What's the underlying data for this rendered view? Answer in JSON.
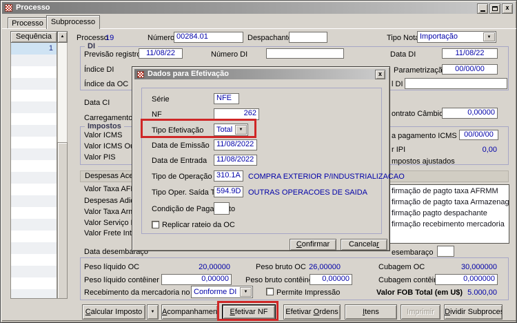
{
  "colors": {
    "accent_blue": "#0000a8",
    "annotation_red": "#cf2727",
    "selection_blue": "#cfe3f3"
  },
  "window": {
    "title": "Processo"
  },
  "tabs": {
    "items": [
      {
        "label": "Processo"
      },
      {
        "label": "Subprocesso"
      }
    ],
    "active": "Subprocesso"
  },
  "sidebar": {
    "header": "Sequência",
    "selected_row": "1"
  },
  "top": {
    "processo_label": "Processo",
    "processo_value": "19",
    "numero_po_label": "Número PO",
    "numero_po_value": "00284.01",
    "despachante_label": "Despachante",
    "despachante_value": "",
    "tipo_nota_label": "Tipo Nota",
    "tipo_nota_value": "Importação"
  },
  "di": {
    "title": "DI",
    "previsao_registro_label": "Previsão registro",
    "previsao_registro_value": "11/08/22",
    "numero_di_label": "Número DI",
    "numero_di_value": "",
    "data_di_label": "Data DI",
    "data_di_value": "11/08/22",
    "indice_di_label": "Índice DI",
    "parametrizacao_di_label": "Parametrização DI",
    "parametrizacao_di_value": "00/00/00",
    "indice_da_oc_label": "Índice da OC",
    "canal_di_label_fragment": "l DI",
    "canal_di_value": ""
  },
  "middle": {
    "data_ci_label": "Data CI",
    "carregamento_label": "Carregamento",
    "contrato_cambio_label_fragment": "ontrato Câmbio",
    "contrato_cambio_value": "0,00000"
  },
  "impostos": {
    "title": "Impostos",
    "valor_icms_label": "Valor ICMS",
    "valor_icms_outros_label": "Valor ICMS Outros",
    "valor_pis_label": "Valor PIS",
    "pagamento_icms_label_fragment": "a pagamento ICMS",
    "pagamento_icms_value": "00/00/00",
    "ipi_label_fragment": "r IPI",
    "ipi_value": "0,00",
    "ajustados_label_fragment": "mpostos ajustados"
  },
  "despesas": {
    "tab_label_fragment": "Despesas Acessória",
    "rows": [
      "Valor Taxa AFRMM",
      "Despesas Adiciona",
      "Valor Taxa Armaze",
      "Valor Serviço Desp",
      "Valor Frete Interno"
    ]
  },
  "confirmacoes": {
    "items": [
      "firmação de pagto taxa AFRMM",
      "firmação de pagto taxa Armazenagem",
      "firmação pagto despachante",
      "firmação recebimento mercadoria"
    ]
  },
  "desembaraco": {
    "left_label": "Data desembaraço",
    "right_label_fragment": "esembaraço",
    "right_value": ""
  },
  "totais": {
    "peso_liquido_oc_label": "Peso líquido OC",
    "peso_liquido_oc_value": "20,00000",
    "peso_bruto_oc_label": "Peso bruto OC",
    "peso_bruto_oc_value": "26,00000",
    "cubagem_oc_label": "Cubagem OC",
    "cubagem_oc_value": "30,000000",
    "peso_liquido_cont_label": "Peso líquido contêiner",
    "peso_liquido_cont_value": "0,00000",
    "peso_bruto_cont_label": "Peso bruto contêiner",
    "peso_bruto_cont_value": "0,00000",
    "cubagem_cont_label": "Cubagem contêiner",
    "cubagem_cont_value": "0,000000",
    "recebimento_label": "Recebimento da mercadoria no CD",
    "recebimento_value": "Conforme DI",
    "permite_label": "Permite Impressão",
    "fob_label": "Valor FOB Total (em U$)",
    "fob_value": "5.000,00"
  },
  "actions": {
    "buttons": [
      {
        "label": "Calcular Imposto",
        "disabled": false
      },
      {
        "label": "Acompanhamento",
        "disabled": false
      },
      {
        "label": "Efetivar NF",
        "disabled": false
      },
      {
        "label": "Efetivar Ordens",
        "disabled": false
      },
      {
        "label": "Itens",
        "disabled": false
      },
      {
        "label": "Imprimir",
        "disabled": true
      },
      {
        "label": "Dividir Subprocesso",
        "disabled": false
      }
    ]
  },
  "dialog": {
    "title": "Dados para Efetivação",
    "serie_label": "Série",
    "serie_value": "NFE",
    "nf_label": "NF",
    "nf_value": "262",
    "tipo_efetivacao_label": "Tipo Efetivação",
    "tipo_efetivacao_value": "Total",
    "emissao_label": "Data de Emissão",
    "emissao_value": "11/08/2022",
    "entrada_label": "Data de Entrada",
    "entrada_value": "11/08/2022",
    "tipo_operacao_label": "Tipo de Operação",
    "tipo_operacao_value": "310.1A",
    "tipo_operacao_desc": "COMPRA EXTERIOR  P/INDUSTRIALIZACAO",
    "tipo_oper_saida_label": "Tipo Oper. Saída Terceiro",
    "tipo_oper_saida_value": "594.9D",
    "tipo_oper_saida_desc": "OUTRAS OPERACOES DE SAIDA",
    "condicao_label": "Condição de Pagamento",
    "condicao_value": "",
    "replicar_label": "Replicar rateio da OC",
    "confirmar_label": "Confirmar",
    "cancelar_label": "Cancelar"
  }
}
